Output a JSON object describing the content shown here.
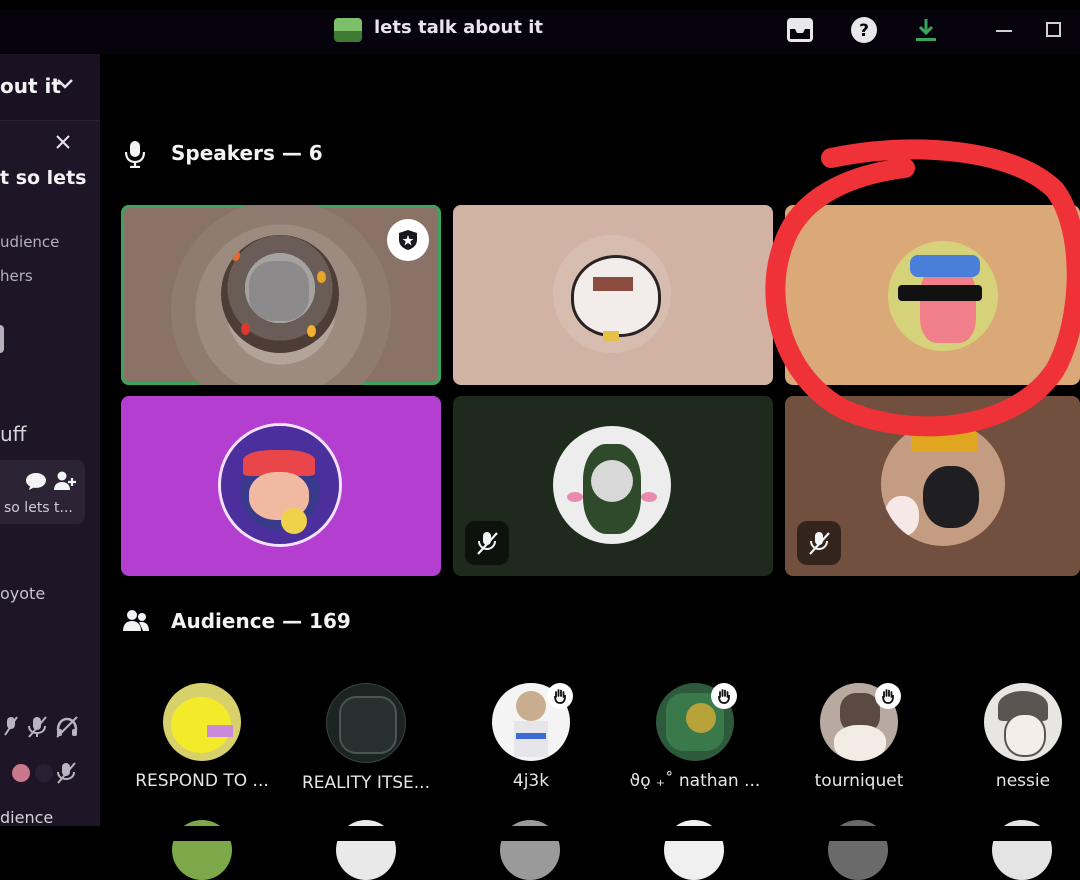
{
  "window": {
    "title": "lets talk about it",
    "controls": [
      "inbox-icon",
      "help-icon",
      "download-icon",
      "minimize-icon",
      "maximize-icon"
    ]
  },
  "sidebar": {
    "header_title": "out it",
    "topic_line": "t so lets",
    "line_audience": "udience",
    "line_others": "hers",
    "section_label": "uff",
    "card_text": "so lets t...",
    "user_line": "oyote",
    "bottom_label": "dience"
  },
  "speakers": {
    "title": "Speakers — 6",
    "tiles": [
      {
        "bg": "#8a7266",
        "moderator": true,
        "active": true,
        "muted": false
      },
      {
        "bg": "#d2b2a2",
        "moderator": false,
        "active": false,
        "muted": false
      },
      {
        "bg": "#dba878",
        "moderator": false,
        "active": false,
        "muted": false
      },
      {
        "bg": "#b43ecf",
        "moderator": false,
        "active": false,
        "muted": false
      },
      {
        "bg": "#1d2a1c",
        "moderator": false,
        "active": false,
        "muted": true
      },
      {
        "bg": "#72503f",
        "moderator": false,
        "active": false,
        "muted": true
      }
    ]
  },
  "audience": {
    "title": "Audience — 169",
    "members": [
      {
        "name": "RESPOND TO ...",
        "hand_raised": false
      },
      {
        "name": "REALITY ITSE...",
        "hand_raised": false
      },
      {
        "name": "4j3k",
        "hand_raised": true
      },
      {
        "name": "ϑǫ ₊˚ nathan ...",
        "hand_raised": true
      },
      {
        "name": "tourniquet",
        "hand_raised": true
      },
      {
        "name": "nessie",
        "hand_raised": false
      }
    ]
  },
  "colors": {
    "accent_green": "#3ba55d",
    "annotation_red": "#ee3237",
    "download_green": "#3ba55d"
  }
}
